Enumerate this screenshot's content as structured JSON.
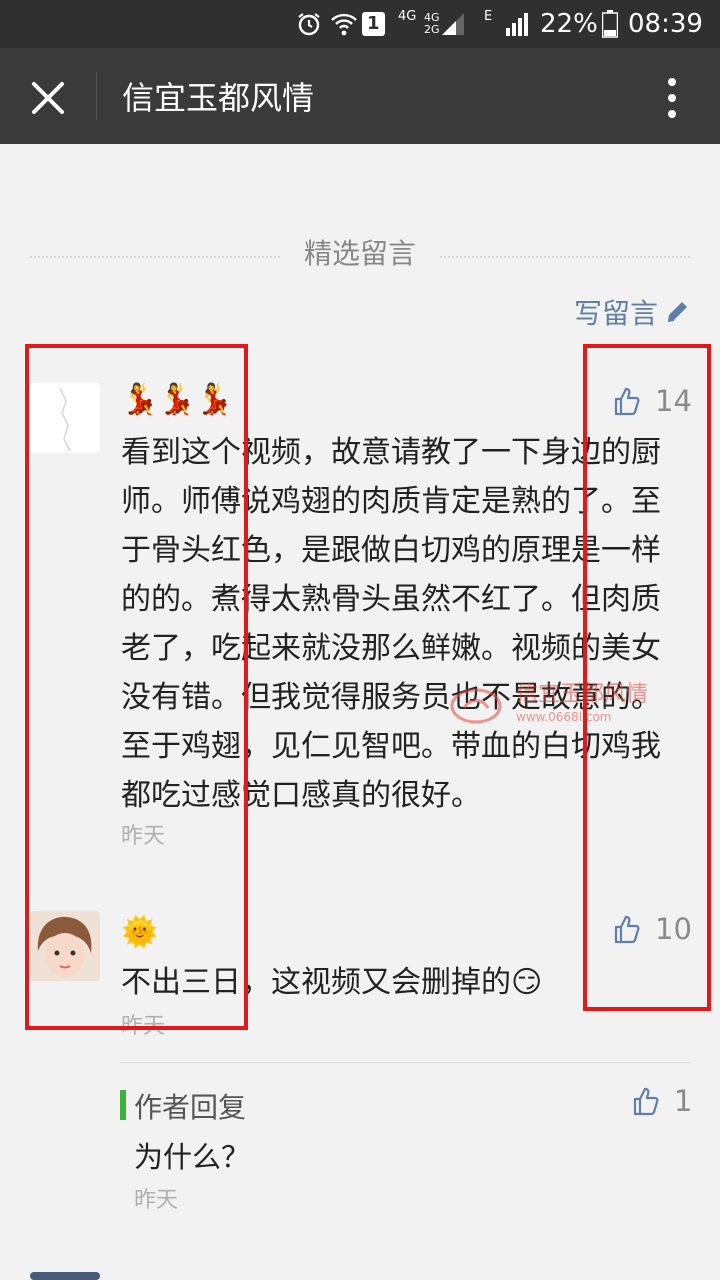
{
  "status_bar": {
    "signal_types": [
      "4G",
      "4G",
      "2G",
      "E"
    ],
    "sim_badge": "1",
    "battery": "22%",
    "time": "08:39"
  },
  "nav": {
    "title": "信宜玉都风情"
  },
  "section": {
    "label": "精选留言",
    "write_label": "写留言"
  },
  "comments": [
    {
      "nickname_emoji": "💃💃💃",
      "text": "看到这个视频，故意请教了一下身边的厨师。师傅说鸡翅的肉质肯定是熟的了。至于骨头红色，是跟做白切鸡的原理是一样的的。煮得太熟骨头虽然不红了。但肉质老了，吃起来就没那么鲜嫩。视频的美女没有错。但我觉得服务员也不是故意的。至于鸡翅，见仁见智吧。带血的白切鸡我都吃过感觉口感真的很好。",
      "time": "昨天",
      "likes": "14"
    },
    {
      "nickname_emoji": "🌞",
      "text": "不出三日，这视频又会删掉的😏",
      "time": "昨天",
      "likes": "10"
    }
  ],
  "reply": {
    "label": "作者回复",
    "text": "为什么？",
    "time": "昨天",
    "likes": "1"
  },
  "watermark": {
    "text": "信宜玉都风情",
    "url": "www.0668l.com"
  },
  "colors": {
    "status_bg": "#303030",
    "nav_bg": "#3a3a3a",
    "page_bg": "#f2f2f2",
    "link_blue": "#5f7fa8",
    "highlight_red": "#e0191b",
    "reply_green": "#3fb13f"
  },
  "icons": [
    "alarm-icon",
    "wifi-icon",
    "signal-icon",
    "battery-icon",
    "close-icon",
    "more-icon",
    "pencil-icon",
    "thumb-up-icon"
  ]
}
